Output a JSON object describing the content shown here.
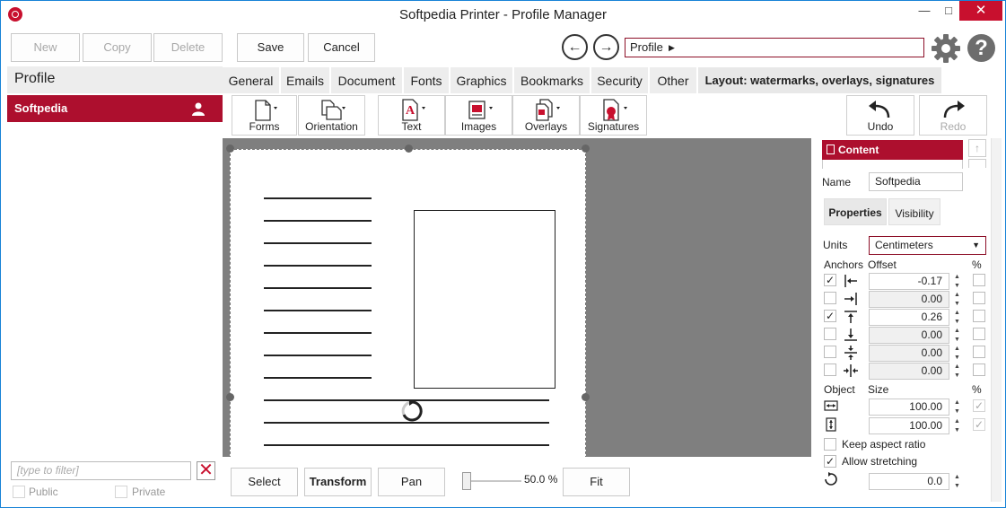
{
  "window": {
    "title": "Softpedia Printer - Profile Manager"
  },
  "toolbar": {
    "new_label": "New",
    "copy_label": "Copy",
    "delete_label": "Delete",
    "save_label": "Save",
    "cancel_label": "Cancel",
    "profile_combo": "Profile"
  },
  "sidebar": {
    "header": "Profile",
    "items": [
      {
        "label": "Softpedia"
      }
    ],
    "filter_placeholder": "[type to filter]",
    "public_label": "Public",
    "private_label": "Private"
  },
  "tabs": [
    {
      "label": "General"
    },
    {
      "label": "Emails"
    },
    {
      "label": "Document"
    },
    {
      "label": "Fonts"
    },
    {
      "label": "Graphics"
    },
    {
      "label": "Bookmarks"
    },
    {
      "label": "Security"
    },
    {
      "label": "Other"
    },
    {
      "label": "Layout: watermarks, overlays, signatures"
    }
  ],
  "ribbon": {
    "forms": "Forms",
    "orientation": "Orientation",
    "text": "Text",
    "images": "Images",
    "overlays": "Overlays",
    "signatures": "Signatures",
    "undo": "Undo",
    "redo": "Redo"
  },
  "bottom": {
    "select": "Select",
    "transform": "Transform",
    "pan": "Pan",
    "zoom": "50.0 %",
    "fit": "Fit"
  },
  "panel": {
    "content_header": "Content",
    "name_label": "Name",
    "name_value": "Softpedia",
    "properties_tab": "Properties",
    "visibility_tab": "Visibility",
    "units_label": "Units",
    "units_value": "Centimeters",
    "anchors_label": "Anchors",
    "offset_label": "Offset",
    "percent_label": "%",
    "offsets": [
      "-0.17",
      "0.00",
      "0.26",
      "0.00",
      "0.00",
      "0.00"
    ],
    "object_label": "Object",
    "size_label": "Size",
    "sizes": [
      "100.00",
      "100.00"
    ],
    "keep_aspect": "Keep aspect ratio",
    "allow_stretching": "Allow stretching",
    "rotation": "0.0"
  },
  "colors": {
    "accent": "#ad0f2e",
    "canvas": "#7f7f7f"
  }
}
